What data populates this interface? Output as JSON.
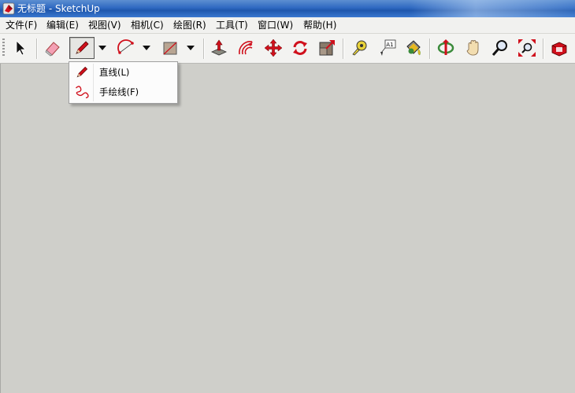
{
  "window": {
    "title": "无标题 - SketchUp"
  },
  "menubar": {
    "items": [
      "文件(F)",
      "编辑(E)",
      "视图(V)",
      "相机(C)",
      "绘图(R)",
      "工具(T)",
      "窗口(W)",
      "帮助(H)"
    ]
  },
  "toolbar": {
    "tools": [
      {
        "name": "select",
        "icon": "arrow-cursor-icon",
        "pressed": false
      },
      {
        "name": "eraser",
        "icon": "eraser-icon",
        "pressed": false
      },
      {
        "name": "line",
        "icon": "pencil-icon",
        "pressed": true
      },
      {
        "name": "arc",
        "icon": "arc-icon",
        "pressed": false
      },
      {
        "name": "rectangle",
        "icon": "rectangle-icon",
        "pressed": false
      },
      {
        "name": "push-pull",
        "icon": "push-pull-icon",
        "pressed": false
      },
      {
        "name": "offset",
        "icon": "offset-icon",
        "pressed": false
      },
      {
        "name": "move",
        "icon": "move-icon",
        "pressed": false
      },
      {
        "name": "rotate",
        "icon": "rotate-icon",
        "pressed": false
      },
      {
        "name": "scale",
        "icon": "scale-icon",
        "pressed": false
      },
      {
        "name": "tape-measure",
        "icon": "tape-measure-icon",
        "pressed": false
      },
      {
        "name": "text",
        "icon": "text-label-icon",
        "pressed": false
      },
      {
        "name": "paint-bucket",
        "icon": "paint-bucket-icon",
        "pressed": false
      },
      {
        "name": "orbit",
        "icon": "orbit-icon",
        "pressed": false
      },
      {
        "name": "pan",
        "icon": "pan-hand-icon",
        "pressed": false
      },
      {
        "name": "zoom",
        "icon": "zoom-icon",
        "pressed": false
      },
      {
        "name": "zoom-extents",
        "icon": "zoom-extents-icon",
        "pressed": false
      },
      {
        "name": "warehouse",
        "icon": "warehouse-icon",
        "pressed": false
      }
    ],
    "text_tool_label": "A1"
  },
  "dropdown": {
    "items": [
      {
        "label": "直线(L)",
        "icon": "pencil-icon"
      },
      {
        "label": "手绘线(F)",
        "icon": "freehand-icon"
      }
    ]
  },
  "colors": {
    "titlebar": "#2f69c1",
    "viewport_bg": "#cfcfca",
    "accent_red": "#d0101c"
  }
}
